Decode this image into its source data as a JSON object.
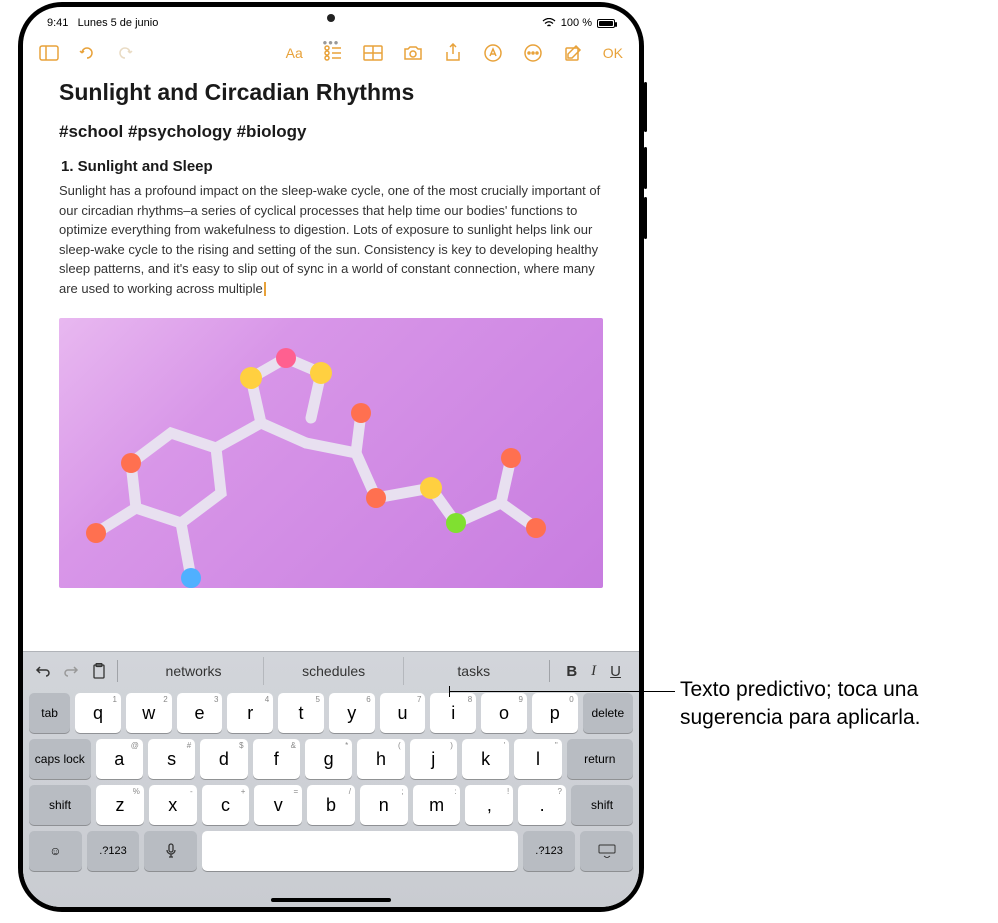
{
  "status": {
    "time": "9:41",
    "date": "Lunes 5 de junio",
    "battery_pct": "100 %",
    "wifi_icon": "wifi-icon"
  },
  "toolbar": {
    "done_label": "OK",
    "aa_label": "Aa"
  },
  "note": {
    "title": "Sunlight and Circadian Rhythms",
    "tags": "#school #psychology #biology",
    "heading": "1. Sunlight and Sleep",
    "body": "Sunlight has a profound impact on the sleep-wake cycle, one of the most crucially important of our circadian rhythms–a series of cyclical processes that help time our bodies' functions to optimize everything from wakefulness to digestion. Lots of exposure to sunlight helps link our sleep-wake cycle to the rising and setting of the sun. Consistency is key to developing healthy sleep patterns, and it's easy to slip out of sync in a world of constant connection, where many are used to working across multiple"
  },
  "predictive": {
    "suggestions": [
      "networks",
      "schedules",
      "tasks"
    ],
    "format": {
      "bold": "B",
      "italic": "I",
      "underline": "U"
    }
  },
  "keyboard": {
    "row1_subs": [
      "1",
      "2",
      "3",
      "4",
      "5",
      "6",
      "7",
      "8",
      "9",
      "0"
    ],
    "row1": [
      "q",
      "w",
      "e",
      "r",
      "t",
      "y",
      "u",
      "i",
      "o",
      "p"
    ],
    "row2_subs": [
      "@",
      "#",
      "$",
      "&",
      "*",
      "(",
      ")",
      "'",
      "\""
    ],
    "row2": [
      "a",
      "s",
      "d",
      "f",
      "g",
      "h",
      "j",
      "k",
      "l"
    ],
    "row3_subs": [
      "%",
      "-",
      "+",
      "=",
      "/",
      ";",
      ":",
      "!",
      "?"
    ],
    "row3": [
      "z",
      "x",
      "c",
      "v",
      "b",
      "n",
      "m",
      ",",
      "."
    ],
    "tab": "tab",
    "delete": "delete",
    "caps": "caps lock",
    "return": "return",
    "shift": "shift",
    "numkey": ".?123"
  },
  "callout": {
    "text": "Texto predictivo; toca una sugerencia para aplicarla."
  },
  "colors": {
    "accent": "#e8a23a"
  }
}
